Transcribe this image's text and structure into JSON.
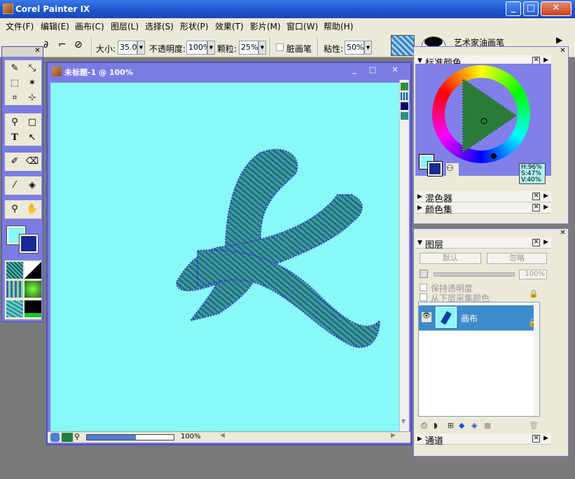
{
  "app": {
    "title": "Corel Painter IX"
  },
  "window_buttons": {
    "minimize": "_",
    "maximize": "□",
    "close": "✕"
  },
  "menu": [
    "文件(F)",
    "编辑(E)",
    "画布(C)",
    "图层(L)",
    "选择(S)",
    "形状(P)",
    "效果(T)",
    "影片(M)",
    "窗口(W)",
    "帮助(H)"
  ],
  "propbar": {
    "size_label": "大小:",
    "size_value": "35.0",
    "opacity_label": "不透明度:",
    "opacity_value": "100%",
    "grain_label": "颗粒:",
    "grain_value": "25%",
    "dirty_label": "脏画笔",
    "viscosity_label": "粘性:",
    "viscosity_value": "50%",
    "brush_category": "艺术家油画笔"
  },
  "document": {
    "title": "未标题-1 @ 100%",
    "zoom": "100%",
    "canvas_color": "#88f8f8",
    "stroke_color": "#2a8a8a"
  },
  "color_panel": {
    "title": "标准颜色",
    "H": "H:96%",
    "S": "S:47%",
    "V": "V:40%",
    "primary_color": "#88f8f8",
    "secondary_color": "#1a2a90",
    "sections": [
      "混色器",
      "颜色集"
    ]
  },
  "layers_panel": {
    "title": "图层",
    "composite_method": "默认",
    "depth": "忽略",
    "opacity": "100%",
    "preserve_transparency": "保持透明度",
    "pick_up_color": "从下层采集颜色",
    "layers": [
      {
        "name": "画布"
      }
    ],
    "channels_section": "通道"
  }
}
